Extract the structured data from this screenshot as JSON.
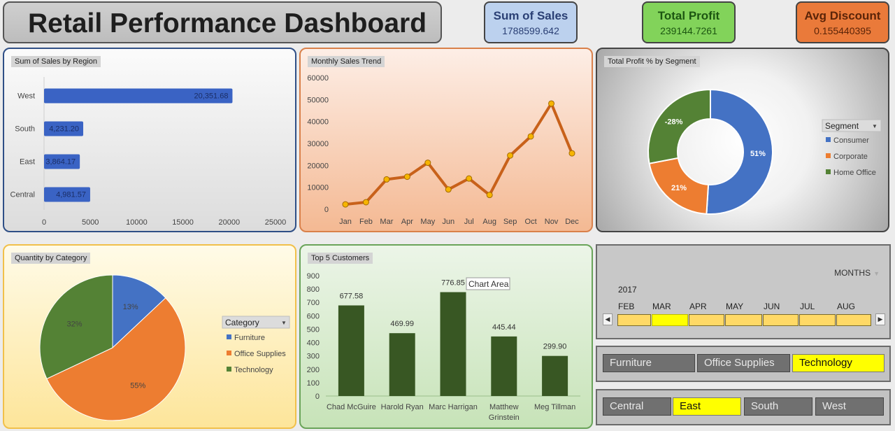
{
  "header": {
    "title": "Retail Performance Dashboard"
  },
  "kpis": {
    "sales": {
      "label": "Sum of Sales",
      "value": "1788599.642"
    },
    "profit": {
      "label": "Total Profit",
      "value": "239144.7261"
    },
    "discount": {
      "label": "Avg Discount",
      "value": "0.155440395"
    }
  },
  "colors": {
    "bar_blue": "#3a63c4",
    "line_orange": "#c8611a",
    "marker": "#f7b500",
    "consumer": "#4472c4",
    "corporate": "#ed7d31",
    "home_office": "#548235",
    "bar_green": "#385723",
    "slicer_selected": "#ffff00",
    "timeline_cell": "#ffd966"
  },
  "chart_data": [
    {
      "type": "bar",
      "title": "Sum of Sales by Region",
      "orientation": "horizontal",
      "categories": [
        "West",
        "South",
        "East",
        "Central"
      ],
      "values": [
        20351.68,
        4231.2,
        3864.17,
        4981.57
      ],
      "value_labels": [
        "20,351.68",
        "4,231.20",
        "3,864.17",
        "4,981.57"
      ],
      "x_ticks": [
        "0",
        "5000",
        "10000",
        "15000",
        "20000",
        "25000"
      ],
      "xlim": [
        0,
        25000
      ],
      "grid": false
    },
    {
      "type": "line",
      "title": "Monthly Sales Trend",
      "categories": [
        "Jan",
        "Feb",
        "Mar",
        "Apr",
        "May",
        "Jun",
        "Jul",
        "Aug",
        "Sep",
        "Oct",
        "Nov",
        "Dec"
      ],
      "values": [
        2200,
        3200,
        13600,
        14800,
        21200,
        9000,
        14000,
        6500,
        24500,
        33200,
        48200,
        25500
      ],
      "y_ticks": [
        "60000",
        "50000",
        "40000",
        "30000",
        "20000",
        "10000",
        "0"
      ],
      "ylim": [
        0,
        60000
      ],
      "grid": false
    },
    {
      "type": "pie",
      "title": "Total Profit % by Segment",
      "donut": true,
      "labels": [
        "Consumer",
        "Corporate",
        "Home Office"
      ],
      "values": [
        51,
        21,
        28
      ],
      "value_labels": [
        "51%",
        "21%",
        "-28%"
      ],
      "legend_title": "Segment",
      "legend_position": "right"
    },
    {
      "type": "pie",
      "title": "Quantity by Category",
      "labels": [
        "Furniture",
        "Office Supplies",
        "Technology"
      ],
      "values": [
        13,
        55,
        32
      ],
      "value_labels": [
        "13%",
        "55%",
        "32%"
      ],
      "legend_title": "Category",
      "legend_position": "right"
    },
    {
      "type": "bar",
      "title": "Top 5 Customers",
      "categories": [
        "Chad McGuire",
        "Harold Ryan",
        "Marc Harrigan",
        "Matthew Grinstein",
        "Meg Tillman"
      ],
      "category_lines": [
        [
          "Chad McGuire"
        ],
        [
          "Harold Ryan"
        ],
        [
          "Marc Harrigan"
        ],
        [
          "Matthew",
          "Grinstein"
        ],
        [
          "Meg Tillman"
        ]
      ],
      "values": [
        677.58,
        469.99,
        776.85,
        445.44,
        299.9
      ],
      "value_labels": [
        "677.58",
        "469.99",
        "776.85",
        "445.44",
        "299.90"
      ],
      "y_ticks": [
        "900",
        "800",
        "700",
        "600",
        "500",
        "400",
        "300",
        "200",
        "100",
        "0"
      ],
      "ylim": [
        0,
        900
      ],
      "tooltip": "Chart Area",
      "grid": false
    }
  ],
  "timeline": {
    "level": "MONTHS",
    "year": "2017",
    "months": [
      "FEB",
      "MAR",
      "APR",
      "MAY",
      "JUN",
      "JUL",
      "AUG"
    ],
    "selected": "MAR",
    "prev": "◀",
    "next": "▶"
  },
  "category_slicer": {
    "items": [
      "Furniture",
      "Office Supplies",
      "Technology"
    ],
    "selected": "Technology"
  },
  "region_slicer": {
    "items": [
      "Central",
      "East",
      "South",
      "West"
    ],
    "selected": "East"
  }
}
